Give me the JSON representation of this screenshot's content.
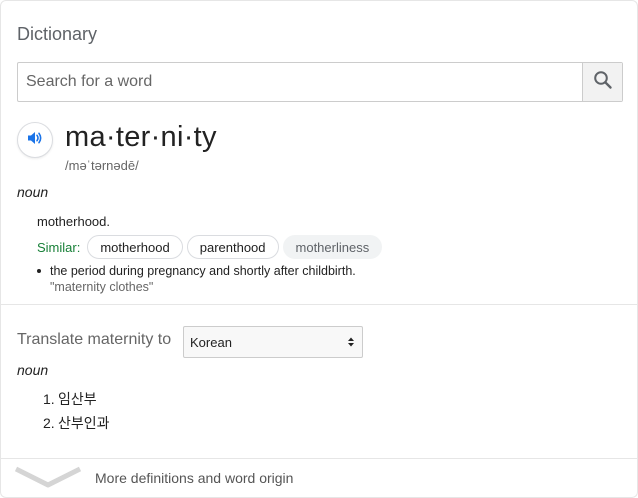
{
  "header": {
    "title": "Dictionary"
  },
  "search": {
    "placeholder": "Search for a word",
    "icon": "search-icon"
  },
  "entry": {
    "word": "ma·ter·ni·ty",
    "phonetic": "/məˈtərnədē/",
    "audio_icon": "speaker-icon",
    "part_of_speech": "noun",
    "senses": [
      {
        "definition": "motherhood."
      },
      {
        "definition": "the period during pregnancy and shortly after childbirth.",
        "example": "\"maternity clothes\""
      }
    ],
    "similar": {
      "label": "Similar:",
      "words": [
        "motherhood",
        "parenthood",
        "motherliness"
      ]
    }
  },
  "translate": {
    "label": "Translate maternity to",
    "language": "Korean",
    "part_of_speech": "noun",
    "items": [
      {
        "num": "1.",
        "text": "임산부"
      },
      {
        "num": "2.",
        "text": "산부인과"
      }
    ]
  },
  "footer": {
    "more_label": "More definitions and word origin",
    "icon": "chevron-down-icon"
  },
  "colors": {
    "similar_label": "#188038",
    "speaker_accent": "#1a73e8"
  }
}
